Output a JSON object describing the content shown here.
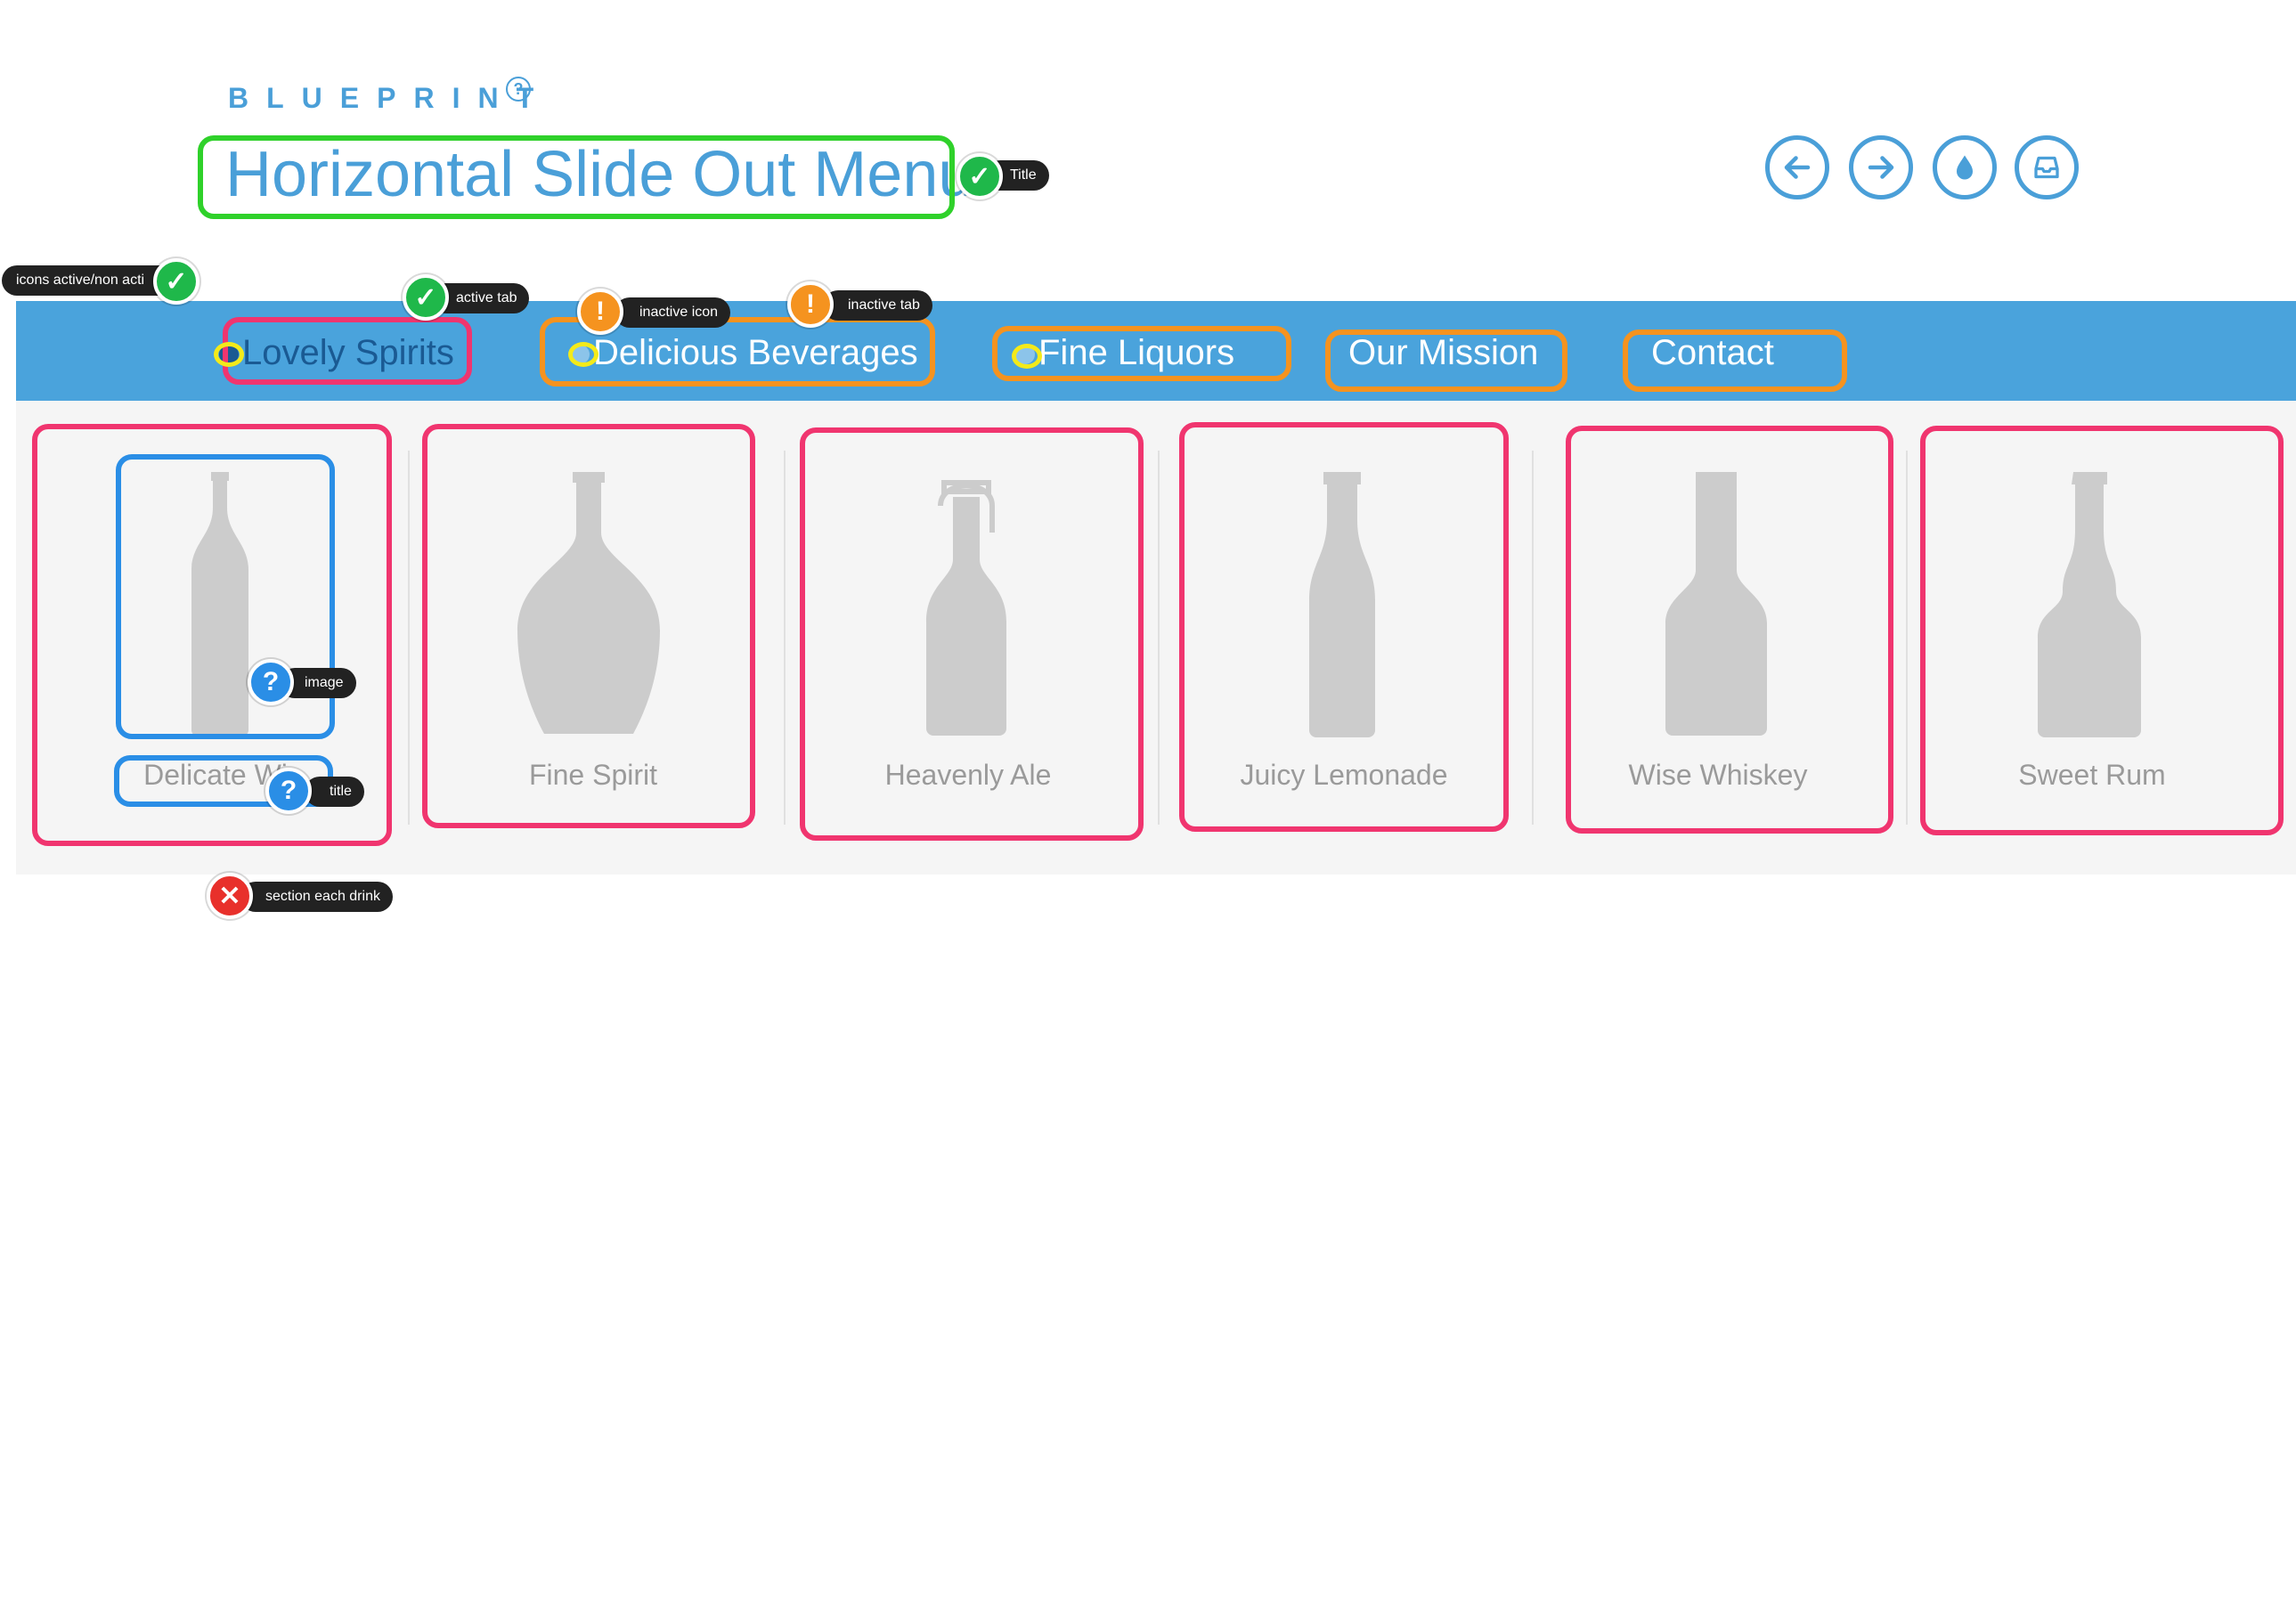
{
  "header": {
    "brand": "BLUEPRINT",
    "brand_help": "?",
    "title": "Horizontal Slide Out Menu"
  },
  "toolbar": {
    "buttons": [
      {
        "icon": "arrow-left-icon"
      },
      {
        "icon": "arrow-right-icon"
      },
      {
        "icon": "drop-icon"
      },
      {
        "icon": "inbox-icon"
      }
    ]
  },
  "nav": {
    "tabs": [
      {
        "label": "Lovely Spirits",
        "active": true
      },
      {
        "label": "Delicious Beverages",
        "active": false
      },
      {
        "label": "Fine Liquors",
        "active": false
      },
      {
        "label": "Our Mission",
        "active": false
      },
      {
        "label": "Contact",
        "active": false
      }
    ]
  },
  "products": [
    {
      "name": "Delicate Wi",
      "bottle": "wine-bottle-icon"
    },
    {
      "name": "Fine Spirit",
      "bottle": "spirit-bottle-icon"
    },
    {
      "name": "Heavenly Ale",
      "bottle": "swing-top-bottle-icon"
    },
    {
      "name": "Juicy Lemonade",
      "bottle": "soda-bottle-icon"
    },
    {
      "name": "Wise Whiskey",
      "bottle": "whiskey-bottle-icon"
    },
    {
      "name": "Sweet Rum",
      "bottle": "rum-bottle-icon"
    }
  ],
  "annotations": {
    "title": "Title",
    "icons": "icons active/non acti",
    "active_tab": "active tab",
    "inactive_icon": "inactive icon",
    "inactive_tab": "inactive tab",
    "image": "image",
    "item_title": "title",
    "section": "section each drink",
    "check": "✓",
    "warn": "!",
    "question": "?",
    "cross": "✕"
  },
  "colors": {
    "accent": "#4aa3dc",
    "active_tab_text": "#1a5a93",
    "product_text": "#9a9a9a",
    "bottle": "#cccccc"
  }
}
